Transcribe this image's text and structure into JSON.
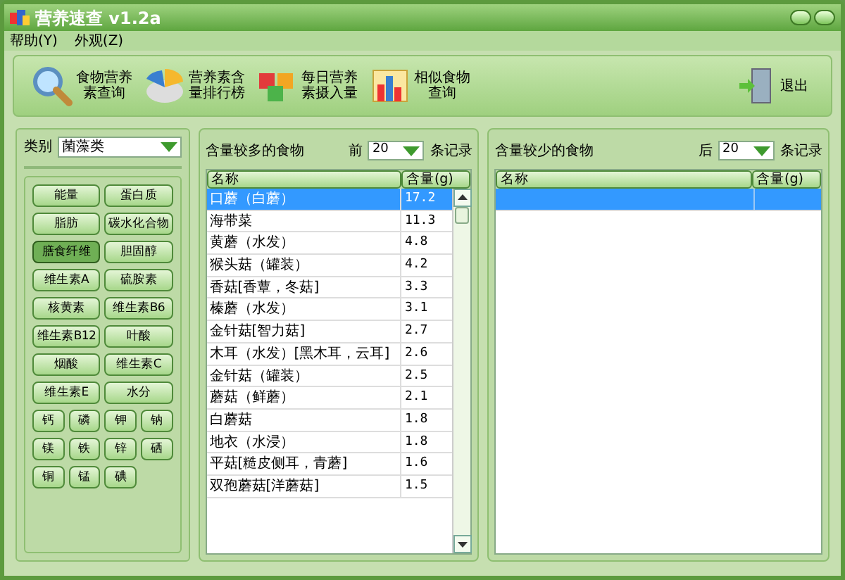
{
  "window": {
    "title": "营养速查 v1.2a"
  },
  "menu": [
    "帮助(Y)",
    "外观(Z)"
  ],
  "toolbar": [
    {
      "label": "食物营养素查询"
    },
    {
      "label": "营养素含量排行榜"
    },
    {
      "label": "每日营养素摄入量"
    },
    {
      "label": "相似食物查询"
    }
  ],
  "exit_button": "退出",
  "category": {
    "label": "类别",
    "value": "菌藻类"
  },
  "nutrients": [
    {
      "label": "能量",
      "kind": "wide",
      "selected": false
    },
    {
      "label": "蛋白质",
      "kind": "wide",
      "selected": false
    },
    {
      "label": "脂肪",
      "kind": "wide",
      "selected": false
    },
    {
      "label": "碳水化合物",
      "kind": "wide",
      "selected": false
    },
    {
      "label": "膳食纤维",
      "kind": "wide",
      "selected": true
    },
    {
      "label": "胆固醇",
      "kind": "wide",
      "selected": false
    },
    {
      "label": "维生素A",
      "kind": "wide",
      "selected": false
    },
    {
      "label": "硫胺素",
      "kind": "wide",
      "selected": false
    },
    {
      "label": "核黄素",
      "kind": "wide",
      "selected": false
    },
    {
      "label": "维生素B6",
      "kind": "wide",
      "selected": false
    },
    {
      "label": "维生素B12",
      "kind": "wide",
      "selected": false
    },
    {
      "label": "叶酸",
      "kind": "wide",
      "selected": false
    },
    {
      "label": "烟酸",
      "kind": "wide",
      "selected": false
    },
    {
      "label": "维生素C",
      "kind": "wide",
      "selected": false
    },
    {
      "label": "维生素E",
      "kind": "wide",
      "selected": false
    },
    {
      "label": "水分",
      "kind": "wide",
      "selected": false
    },
    {
      "label": "钙",
      "kind": "narrow",
      "selected": false
    },
    {
      "label": "磷",
      "kind": "narrow",
      "selected": false
    },
    {
      "label": "钾",
      "kind": "narrow",
      "selected": false
    },
    {
      "label": "钠",
      "kind": "narrow",
      "selected": false
    },
    {
      "label": "镁",
      "kind": "narrow",
      "selected": false
    },
    {
      "label": "铁",
      "kind": "narrow",
      "selected": false
    },
    {
      "label": "锌",
      "kind": "narrow",
      "selected": false
    },
    {
      "label": "硒",
      "kind": "narrow",
      "selected": false
    },
    {
      "label": "铜",
      "kind": "narrow",
      "selected": false
    },
    {
      "label": "锰",
      "kind": "narrow",
      "selected": false
    },
    {
      "label": "碘",
      "kind": "narrow",
      "selected": false
    }
  ],
  "top_panel": {
    "title": "含量较多的食物",
    "prefix": "前",
    "count": "20",
    "suffix": "条记录",
    "columns": [
      "名称",
      "含量(g)"
    ],
    "rows": [
      {
        "name": "口蘑（白蘑）",
        "value": "17.2",
        "selected": true
      },
      {
        "name": "海带菜",
        "value": "11.3",
        "selected": false
      },
      {
        "name": "黄蘑（水发）",
        "value": "4.8",
        "selected": false
      },
      {
        "name": "猴头菇（罐装）",
        "value": "4.2",
        "selected": false
      },
      {
        "name": "香菇[香蕈，冬菇]",
        "value": "3.3",
        "selected": false
      },
      {
        "name": "榛蘑（水发）",
        "value": "3.1",
        "selected": false
      },
      {
        "name": "金针菇[智力菇]",
        "value": "2.7",
        "selected": false
      },
      {
        "name": "木耳（水发）[黑木耳，云耳]",
        "value": "2.6",
        "selected": false
      },
      {
        "name": "金针菇（罐装）",
        "value": "2.5",
        "selected": false
      },
      {
        "name": "蘑菇（鲜蘑）",
        "value": "2.1",
        "selected": false
      },
      {
        "name": "白蘑菇",
        "value": "1.8",
        "selected": false
      },
      {
        "name": "地衣（水浸）",
        "value": "1.8",
        "selected": false
      },
      {
        "name": "平菇[糙皮侧耳，青蘑]",
        "value": "1.6",
        "selected": false
      },
      {
        "name": "双孢蘑菇[洋蘑菇]",
        "value": "1.5",
        "selected": false
      }
    ]
  },
  "bottom_panel": {
    "title": "含量较少的食物",
    "prefix": "后",
    "count": "20",
    "suffix": "条记录",
    "columns": [
      "名称",
      "含量(g)"
    ],
    "rows": [
      {
        "selected": true
      }
    ]
  }
}
